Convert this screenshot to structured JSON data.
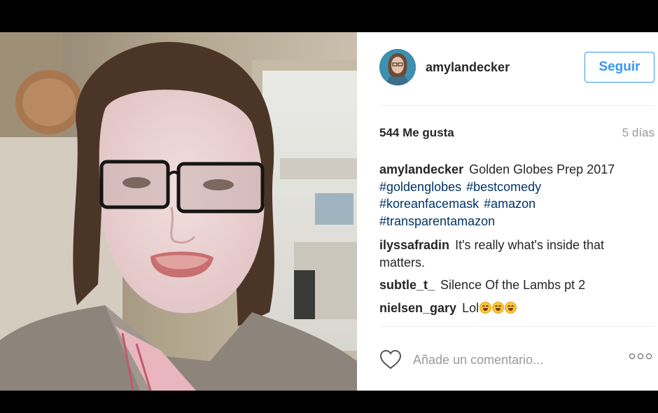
{
  "post": {
    "username": "amylandecker",
    "follow_label": "Seguir",
    "likes": "544 Me gusta",
    "age": "5 días"
  },
  "caption": {
    "author": "amylandecker",
    "text": "Golden Globes Prep 2017",
    "hashtags": [
      "#goldenglobes",
      "#bestcomedy",
      "#koreanfacemask",
      "#amazon",
      "#transparentamazon"
    ]
  },
  "comments": [
    {
      "author": "ilyssafradin",
      "text": "It's really what's inside that matters."
    },
    {
      "author": "subtle_t_",
      "text": "Silence Of the Lambs pt 2"
    },
    {
      "author": "nielsen_gary",
      "text": "Lol",
      "emoji_count": 3
    }
  ],
  "composer": {
    "placeholder": "Añade un comentario...",
    "like_icon": "heart-outline-icon",
    "more_icon": "more-options-icon"
  },
  "colors": {
    "link": "#003569",
    "follow": "#3897f0",
    "muted": "#999999"
  }
}
